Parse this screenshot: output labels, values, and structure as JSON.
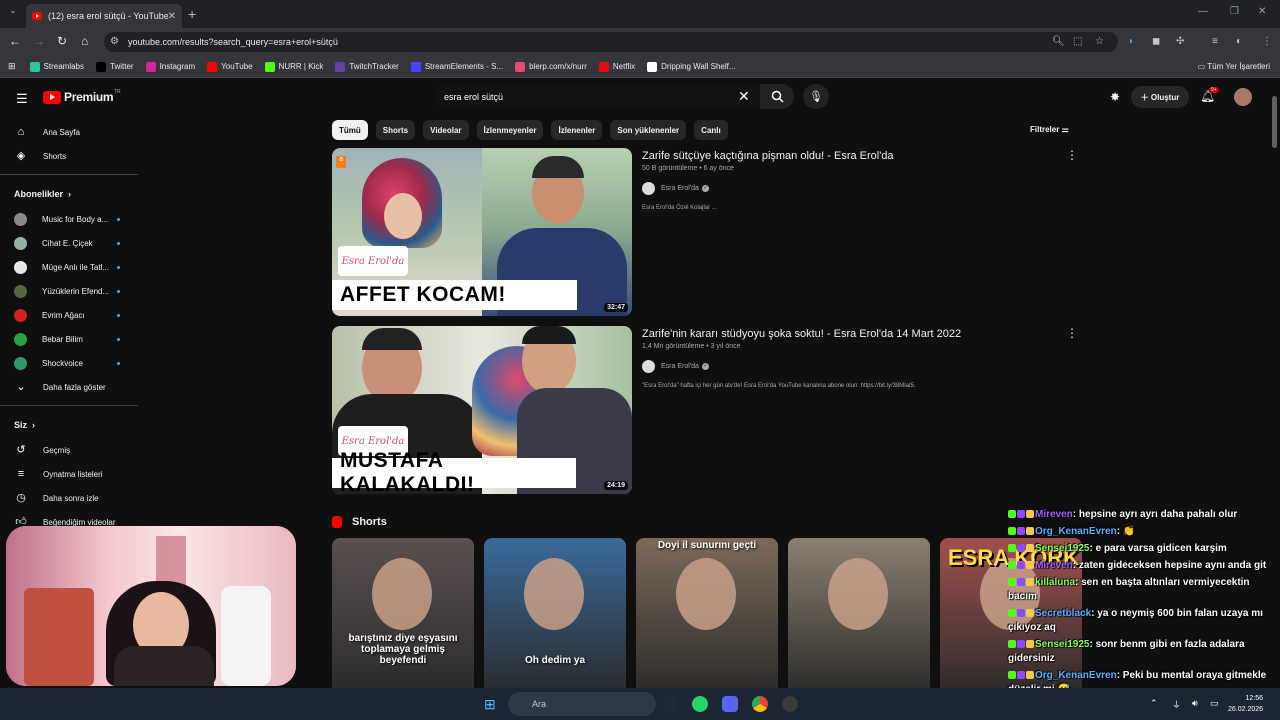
{
  "browser": {
    "tab_title": "(12) esra erol sütçü - YouTube",
    "url": "youtube.com/results?search_query=esra+erol+sütçü",
    "bookmarks": [
      {
        "label": "Streamlabs",
        "color": "#31c3a2"
      },
      {
        "label": "Twitter",
        "color": "#000000"
      },
      {
        "label": "Instagram",
        "color": "#d6249f"
      },
      {
        "label": "YouTube",
        "color": "#ff0000"
      },
      {
        "label": "NURR | Kick",
        "color": "#53fc18"
      },
      {
        "label": "TwitchTracker",
        "color": "#6441a5"
      },
      {
        "label": "StreamElements - S...",
        "color": "#4b44ff"
      },
      {
        "label": "blerp.com/x/nurr",
        "color": "#e84878"
      },
      {
        "label": "Netflix",
        "color": "#e50914"
      },
      {
        "label": "Dripping Wall Shelf...",
        "color": "#ffffff"
      }
    ],
    "all_bookmarks": "Tüm Yer İşaretleri"
  },
  "youtube": {
    "logo": "Premium",
    "logo_sup": "TR",
    "search_value": "esra erol sütçü",
    "create_label": "Oluştur",
    "notif_count": "9+",
    "sidebar": {
      "home": "Ana Sayfa",
      "shorts": "Shorts",
      "subs_header": "Abonelikler",
      "subs": [
        {
          "label": "Music for Body a...",
          "color": "#8a8a8a"
        },
        {
          "label": "Cihat E. Çiçek",
          "color": "#9ab0a0"
        },
        {
          "label": "Müge Anlı ile Tatl...",
          "color": "#e8e8e8"
        },
        {
          "label": "Yüzüklerin Efend...",
          "color": "#556644"
        },
        {
          "label": "Evrim Ağacı",
          "color": "#d02020"
        },
        {
          "label": "Bebar Bilim",
          "color": "#2aa040"
        },
        {
          "label": "Shockvoice",
          "color": "#2a9a6a"
        }
      ],
      "show_more": "Daha fazla göster",
      "you_header": "Siz",
      "history": "Geçmiş",
      "playlists": "Oynatma listeleri",
      "watch_later": "Daha sonra izle",
      "liked": "Beğendiğim videolar"
    },
    "chips": [
      "Tümü",
      "Shorts",
      "Videolar",
      "İzlenmeyenler",
      "İzlenenler",
      "Son yüklenenler",
      "Canlı"
    ],
    "filters": "Filtreler",
    "results": [
      {
        "title": "Zarife sütçüye kaçtığına pişman oldu! - Esra Erol'da",
        "meta": "50 B görüntüleme • 6 ay önce",
        "channel": "Esra Erol'da",
        "desc": "Esra Erol'da Özel Kolajlar ...",
        "duration": "32:47",
        "caption": "AFFET KOCAM!",
        "tag": "Esra Erol'da"
      },
      {
        "title": "Zarife'nin kararı stüdyoyu şoka soktu! - Esra Erol'da 14 Mart 2022",
        "meta": "1,4 Mn görüntüleme • 3 yıl önce",
        "channel": "Esra Erol'da",
        "desc": "\"Esra Erol'da\" hafta içi her gün atv'de! Esra Erol'da YouTube kanalına abone olun: https://bit.ly/38Mlat5.",
        "duration": "24:19",
        "caption": "MUSTAFA KALAKALDI!",
        "tag": "Esra Erol'da"
      }
    ],
    "shorts_header": "Shorts",
    "shorts": [
      {
        "caption": "barıştınız diye eşyasını toplamaya gelmiş beyefendi",
        "bg": "#5a5050"
      },
      {
        "caption": "Oh dedim ya",
        "bg": "#3a6a9a"
      },
      {
        "caption": "Doyi il sunurını geçti",
        "bg": "#7a6a5a"
      },
      {
        "caption": "",
        "bg": "#8a8070"
      },
      {
        "caption": "ESRA KORK",
        "bg": "#a05050"
      }
    ]
  },
  "chat": [
    {
      "name": "Mireven",
      "text": ": hepsine ayrı ayrı daha pahalı olur",
      "cls": "p"
    },
    {
      "name": "Org_KenanEvren",
      "text": ": 👏",
      "cls": ""
    },
    {
      "name": "Sensei1925",
      "text": ": e para varsa gidicen karşim",
      "cls": "g"
    },
    {
      "name": "Mireven",
      "text": ": zaten gideceksen hepsine aynı anda git",
      "cls": "p"
    },
    {
      "name": "killaluna",
      "text": ": sen en başta altınları vermiyecektin bacım",
      "cls": "g"
    },
    {
      "name": "Secretblack",
      "text": ": ya o neymiş 600 bin falan uzaya mı çıkıyoz aq",
      "cls": ""
    },
    {
      "name": "Sensei1925",
      "text": ": sonr benm gibi en fazla adalara gidersiniz",
      "cls": "g"
    },
    {
      "name": "Org_KenanEvren",
      "text": ": Peki bu mental oraya gitmekle düzelir mi 😅",
      "cls": ""
    }
  ],
  "taskbar": {
    "search": "Ara",
    "time": "12:56",
    "date": "26.02.2026"
  }
}
